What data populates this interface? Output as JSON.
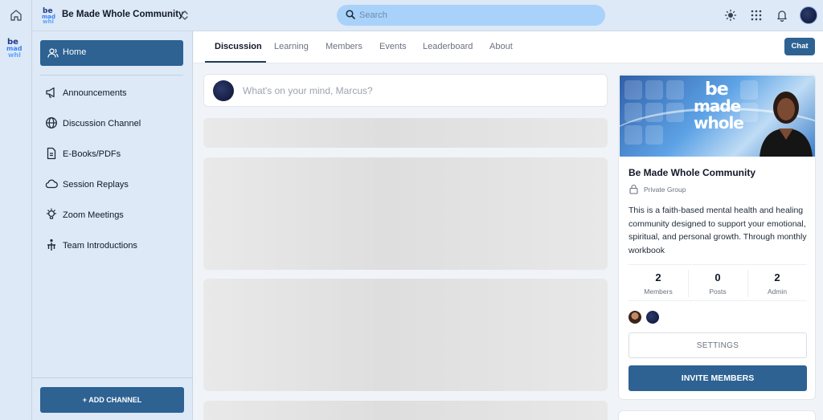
{
  "topbar": {
    "community_name": "Be Made Whole Community",
    "logo_text": "be made whole",
    "search_placeholder": "Search",
    "icons": [
      "home-icon",
      "chevron-updown-icon",
      "search-icon",
      "sun-icon",
      "apps-grid-icon",
      "bell-icon"
    ]
  },
  "sidebar": {
    "home_label": "Home",
    "items": [
      {
        "label": "Announcements",
        "icon": "megaphone-icon"
      },
      {
        "label": "Discussion Channel",
        "icon": "globe-icon"
      },
      {
        "label": "E-Books/PDFs",
        "icon": "document-icon"
      },
      {
        "label": "Session Replays",
        "icon": "cloud-icon"
      },
      {
        "label": "Zoom Meetings",
        "icon": "lightbulb-icon"
      },
      {
        "label": "Team Introductions",
        "icon": "team-icon"
      }
    ],
    "add_channel_label": "+ ADD CHANNEL"
  },
  "tabs": {
    "items": [
      "Discussion",
      "Learning",
      "Members",
      "Events",
      "Leaderboard",
      "About"
    ],
    "active": "Discussion",
    "chat_label": "Chat"
  },
  "feed": {
    "composer_placeholder": "What's on your mind, Marcus?"
  },
  "group_card": {
    "cover_logo_text": "be made whole",
    "title": "Be Made Whole Community",
    "privacy": "Private Group",
    "description": "This is a faith-based mental health and healing community designed to support your emotional, spiritual, and personal growth. Through monthly workbook",
    "stats": [
      {
        "value": "2",
        "label": "Members"
      },
      {
        "value": "0",
        "label": "Posts"
      },
      {
        "value": "2",
        "label": "Admin"
      }
    ],
    "settings_label": "SETTINGS",
    "invite_label": "INVITE MEMBERS"
  },
  "colors": {
    "primary": "#2d6292",
    "sidebar_bg": "#dde9f7",
    "search_bg": "#a9d2fa"
  }
}
